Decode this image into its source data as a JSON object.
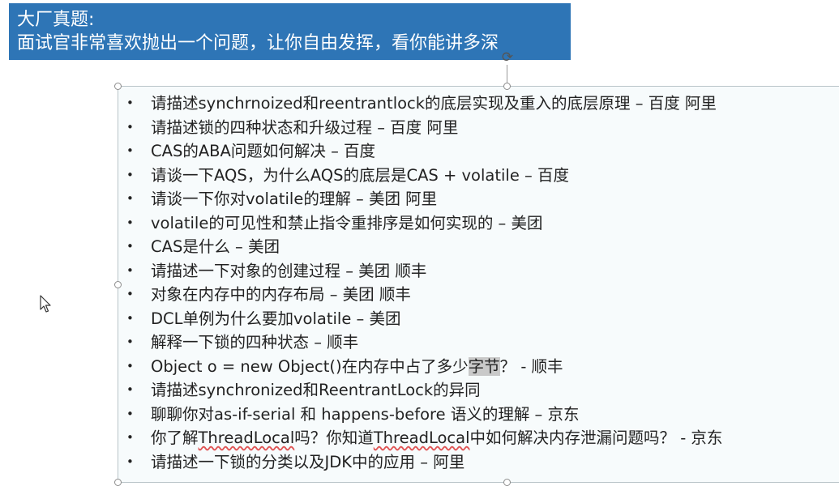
{
  "title": {
    "line1": "大厂真题:",
    "line2": "面试官非常喜欢抛出一个问题，让你自由发挥，看你能讲多深"
  },
  "items": [
    {
      "text": "请描述synchrnoized和reentrantlock的底层实现及重入的底层原理 – 百度 阿里"
    },
    {
      "text": "请描述锁的四种状态和升级过程 – 百度 阿里"
    },
    {
      "text": "CAS的ABA问题如何解决 – 百度"
    },
    {
      "text": "请谈一下AQS，为什么AQS的底层是CAS + volatile – 百度"
    },
    {
      "text": "请谈一下你对volatile的理解 – 美团 阿里"
    },
    {
      "text": "volatile的可见性和禁止指令重排序是如何实现的 – 美团"
    },
    {
      "text": "CAS是什么 – 美团"
    },
    {
      "text": "请描述一下对象的创建过程 – 美团 顺丰"
    },
    {
      "text": "对象在内存中的内存布局 – 美团 顺丰"
    },
    {
      "text": "DCL单例为什么要加volatile – 美团"
    },
    {
      "text": "解释一下锁的四种状态 – 顺丰"
    },
    {
      "pre": "Object o = new Object()在内存中占了多少",
      "hl": "字节",
      "post": "？ - 顺丰"
    },
    {
      "text": "请描述synchronized和ReentrantLock的异同"
    },
    {
      "text": "聊聊你对as-if-serial 和 happens-before 语义的理解 – 京东"
    },
    {
      "p1": "你了解",
      "u1": "ThreadLocal",
      "p2": "吗？你知道",
      "u2": "ThreadLocal",
      "p3": "中如何解决内存泄漏问题吗？ - 京东"
    },
    {
      "text": "请描述一下锁的分类以及JDK中的应用 – 阿里"
    }
  ],
  "bullet": "•",
  "icons": {
    "rotate": "rotate-handle-icon",
    "cursor": "mouse-pointer-icon"
  },
  "colors": {
    "title_bg": "#2e75b6",
    "title_text": "#ffffff",
    "box_bg": "#f7fbfc",
    "highlight": "#c9c9c9",
    "squiggle": "#e05555"
  }
}
